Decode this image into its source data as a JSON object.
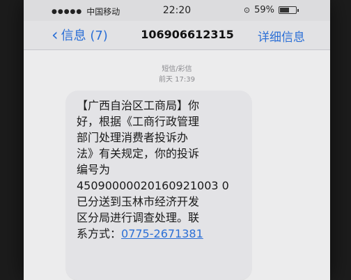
{
  "status_bar": {
    "signal": "●●●●●",
    "carrier": "中国移动",
    "time": "22:20",
    "battery_percent": "59%",
    "battery_level": 0.59
  },
  "nav": {
    "back_label": "信息 (7)",
    "title": "106906612315",
    "detail_label": "详细信息"
  },
  "thread": {
    "message_type": "短信/彩信",
    "timestamp": "前天 17:39",
    "message_lines": [
      "【广西自治区工商局】你",
      "好，根据《工商行政管理",
      "部门处理消费者投诉办",
      "法》有关规定，你的投诉",
      "编号为",
      "45090000020160921003 0",
      "已分送到玉林市经济开发",
      "区分局进行调查处理。联",
      "系方式："
    ],
    "phone_number": "0775-2671381"
  },
  "colors": {
    "accent": "#2b6fd6",
    "bubble": "#e3e3e6"
  }
}
